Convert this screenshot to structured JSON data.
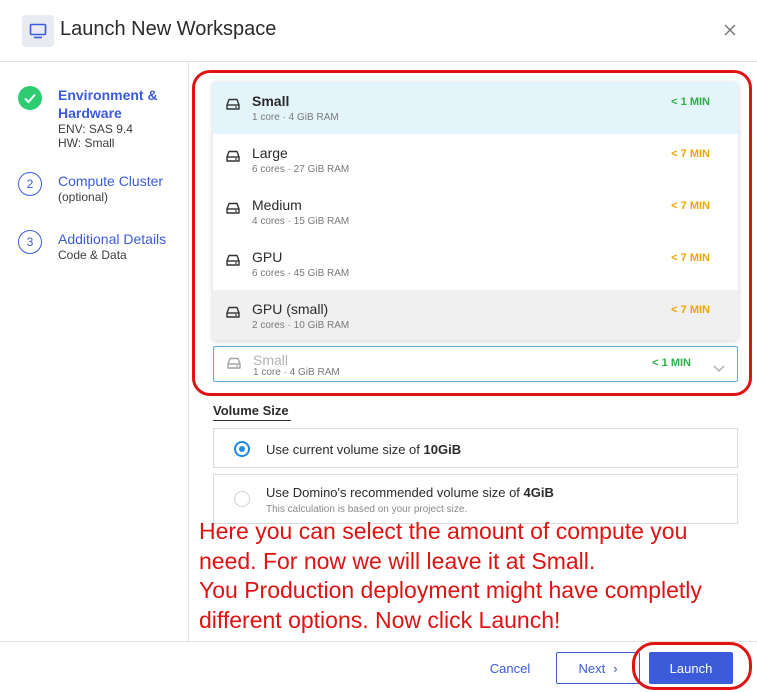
{
  "header": {
    "title": "Launch New Workspace",
    "icon": "monitor-icon",
    "close_icon": "close-icon"
  },
  "steps": [
    {
      "state": "done",
      "title": "Environment & Hardware",
      "lines": [
        "ENV: SAS 9.4",
        "HW: Small"
      ]
    },
    {
      "state": "todo",
      "number": "2",
      "title": "Compute Cluster",
      "lines": [
        "(optional)"
      ]
    },
    {
      "state": "todo",
      "number": "3",
      "title": "Additional Details",
      "lines": [
        "Code & Data"
      ]
    }
  ],
  "hardware": {
    "items": [
      {
        "name": "Small",
        "spec": "1 core · 4 GiB RAM",
        "time": "< 1 MIN",
        "time_color": "#2eaf44",
        "selected": true
      },
      {
        "name": "Large",
        "spec": "6 cores · 27 GiB RAM",
        "time": "< 7 MIN",
        "time_color": "#f0a500"
      },
      {
        "name": "Medium",
        "spec": "4 cores · 15 GiB RAM",
        "time": "< 7 MIN",
        "time_color": "#f0a500"
      },
      {
        "name": "GPU",
        "spec": "6 cores · 45 GiB RAM",
        "time": "< 7 MIN",
        "time_color": "#f0a500"
      },
      {
        "name": "GPU (small)",
        "spec": "2 cores · 10 GiB RAM",
        "time": "< 7 MIN",
        "time_color": "#f0a500",
        "hovered": true
      }
    ],
    "current": {
      "name": "Small",
      "spec": "1 core · 4 GiB RAM",
      "time": "< 1 MIN"
    },
    "icon": "hardware-tier-icon"
  },
  "volume": {
    "label": "Volume Size",
    "option1_text": "Use current volume size of ",
    "option1_value": "10GiB",
    "option2_text": "Use Domino's recommended volume size of ",
    "option2_value": "4GiB",
    "option2_note": "This calculation is based on your project size."
  },
  "annotation": [
    "Here you can select the amount of compute you",
    "need. For now we will leave it at Small.",
    "You Production deployment might have completly",
    "different options. Now click Launch!"
  ],
  "footer": {
    "cancel": "Cancel",
    "next": "Next",
    "launch": "Launch"
  },
  "colors": {
    "accent": "#3b5bdb",
    "selected_row": "#e3f4fb",
    "hover_row": "#f0f0f0",
    "fast": "#2eaf44",
    "slow": "#f0a500",
    "annotation": "#e01212",
    "done": "#2ecc71"
  }
}
